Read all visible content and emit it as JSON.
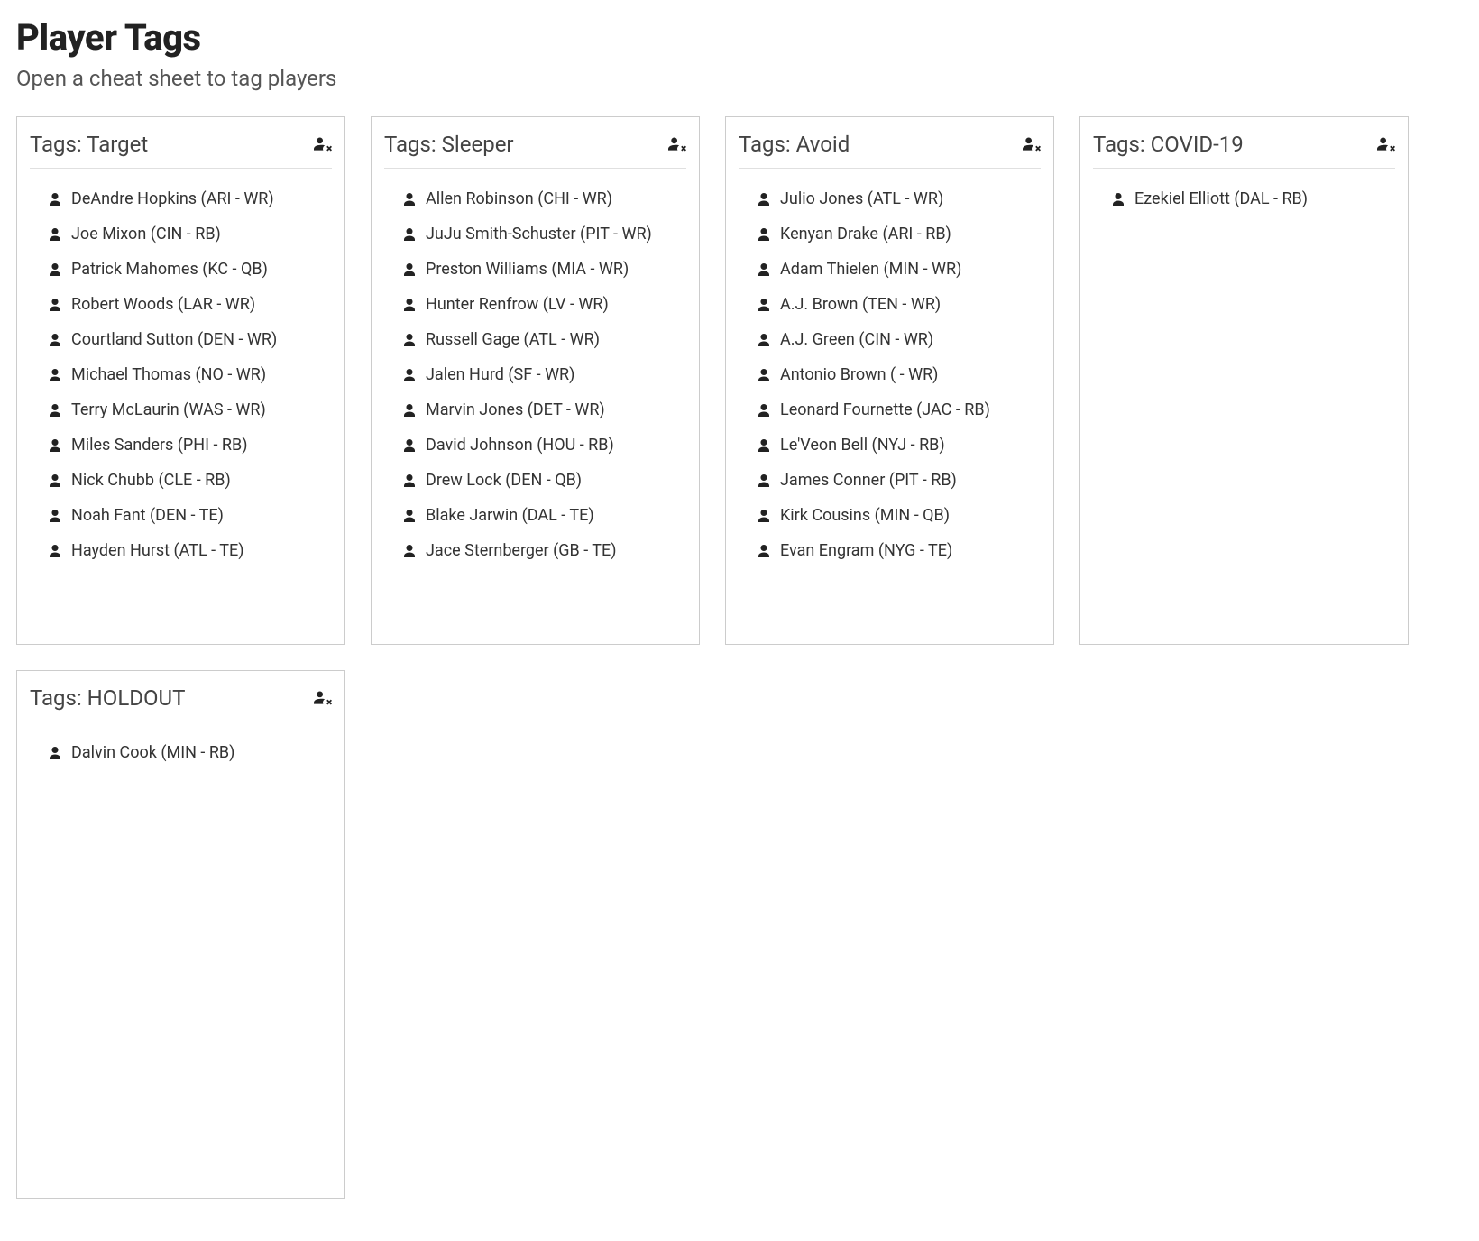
{
  "header": {
    "title": "Player Tags",
    "subtitle": "Open a cheat sheet to tag players"
  },
  "tag_prefix": "Tags: ",
  "cards": [
    {
      "name": "Target",
      "players": [
        "DeAndre Hopkins (ARI - WR)",
        "Joe Mixon (CIN - RB)",
        "Patrick Mahomes (KC - QB)",
        "Robert Woods (LAR - WR)",
        "Courtland Sutton (DEN - WR)",
        "Michael Thomas (NO - WR)",
        "Terry McLaurin (WAS - WR)",
        "Miles Sanders (PHI - RB)",
        "Nick Chubb (CLE - RB)",
        "Noah Fant (DEN - TE)",
        "Hayden Hurst (ATL - TE)"
      ]
    },
    {
      "name": "Sleeper",
      "players": [
        "Allen Robinson (CHI - WR)",
        "JuJu Smith-Schuster (PIT - WR)",
        "Preston Williams (MIA - WR)",
        "Hunter Renfrow (LV - WR)",
        "Russell Gage (ATL - WR)",
        "Jalen Hurd (SF - WR)",
        "Marvin Jones (DET - WR)",
        "David Johnson (HOU - RB)",
        "Drew Lock (DEN - QB)",
        "Blake Jarwin (DAL - TE)",
        "Jace Sternberger (GB - TE)"
      ]
    },
    {
      "name": "Avoid",
      "players": [
        "Julio Jones (ATL - WR)",
        "Kenyan Drake (ARI - RB)",
        "Adam Thielen (MIN - WR)",
        "A.J. Brown (TEN - WR)",
        "A.J. Green (CIN - WR)",
        "Antonio Brown ( - WR)",
        "Leonard Fournette (JAC - RB)",
        "Le'Veon Bell (NYJ - RB)",
        "James Conner (PIT - RB)",
        "Kirk Cousins (MIN - QB)",
        "Evan Engram (NYG - TE)"
      ]
    },
    {
      "name": "COVID-19",
      "players": [
        "Ezekiel Elliott (DAL - RB)"
      ]
    },
    {
      "name": "HOLDOUT",
      "players": [
        "Dalvin Cook (MIN - RB)"
      ]
    }
  ]
}
